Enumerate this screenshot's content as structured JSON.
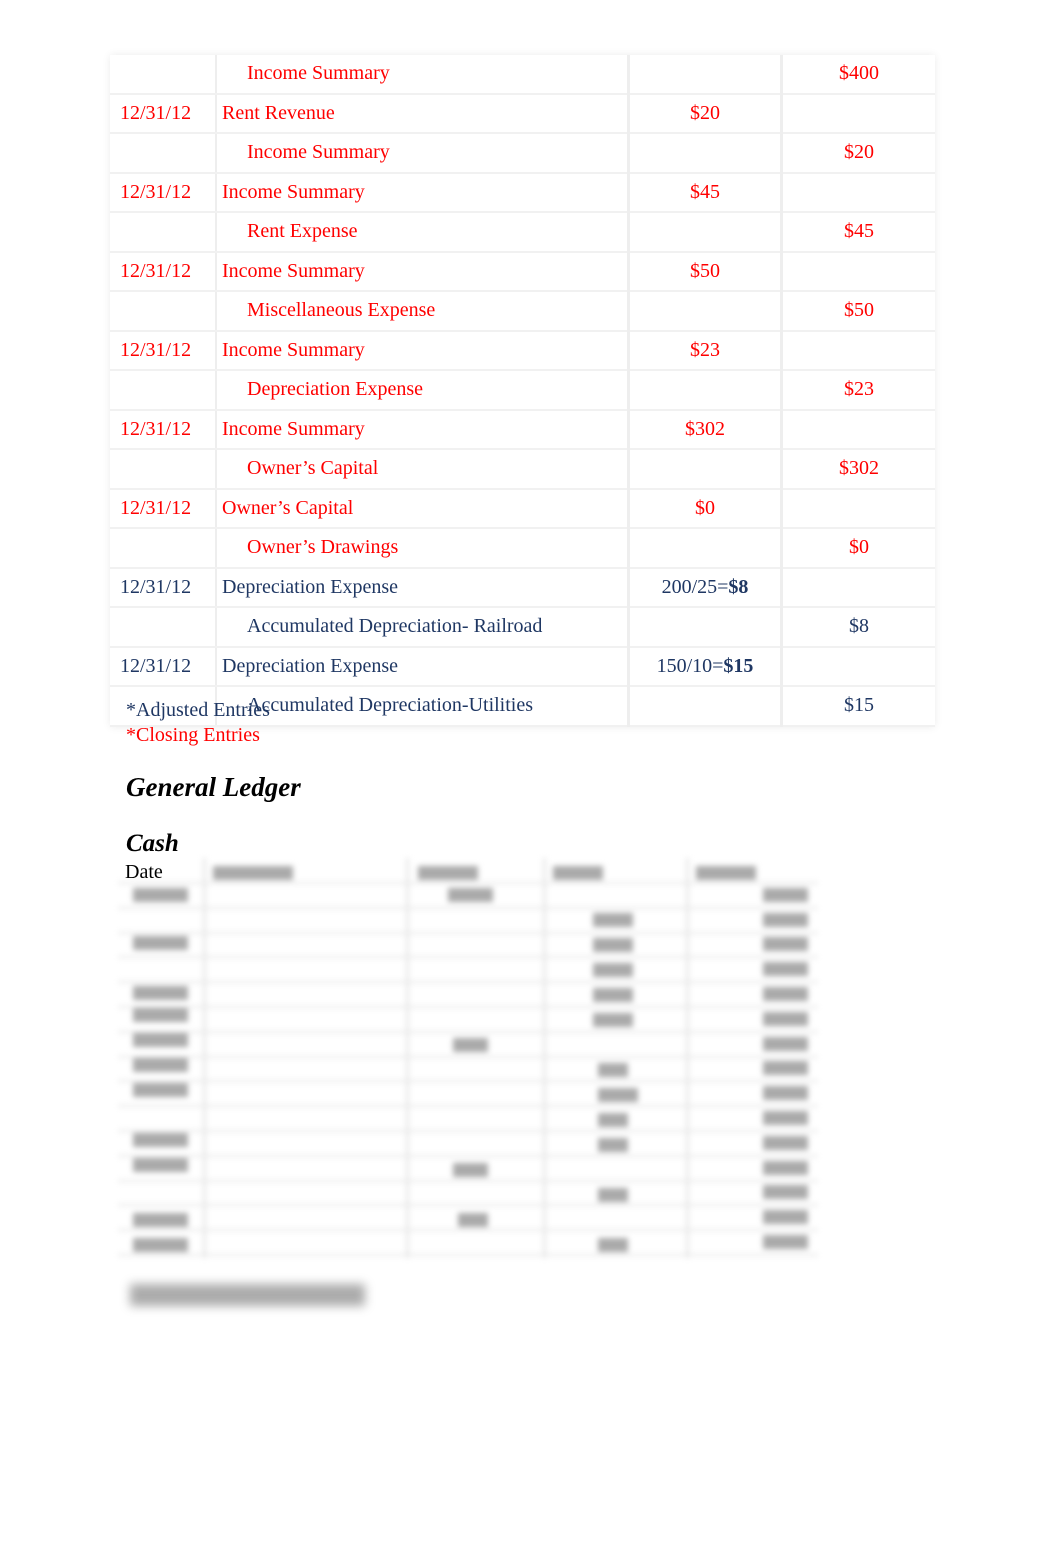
{
  "colors": {
    "closing": "#ff0000",
    "adjusting": "#1f3763"
  },
  "journal": {
    "rows": [
      {
        "date": "",
        "account": "Income Summary",
        "indent": true,
        "debit": "",
        "credit": "$400",
        "type": "closing"
      },
      {
        "date": "12/31/12",
        "account": "Rent Revenue",
        "indent": false,
        "debit": "$20",
        "credit": "",
        "type": "closing"
      },
      {
        "date": "",
        "account": "Income Summary",
        "indent": true,
        "debit": "",
        "credit": "$20",
        "type": "closing"
      },
      {
        "date": "12/31/12",
        "account": "Income Summary",
        "indent": false,
        "debit": "$45",
        "credit": "",
        "type": "closing"
      },
      {
        "date": "",
        "account": "Rent Expense",
        "indent": true,
        "debit": "",
        "credit": "$45",
        "type": "closing"
      },
      {
        "date": "12/31/12",
        "account": "Income Summary",
        "indent": false,
        "debit": "$50",
        "credit": "",
        "type": "closing"
      },
      {
        "date": "",
        "account": "Miscellaneous Expense",
        "indent": true,
        "debit": "",
        "credit": "$50",
        "type": "closing"
      },
      {
        "date": "12/31/12",
        "account": "Income Summary",
        "indent": false,
        "debit": "$23",
        "credit": "",
        "type": "closing"
      },
      {
        "date": "",
        "account": "Depreciation Expense",
        "indent": true,
        "debit": "",
        "credit": "$23",
        "type": "closing"
      },
      {
        "date": "12/31/12",
        "account": "Income Summary",
        "indent": false,
        "debit": "$302",
        "credit": "",
        "type": "closing"
      },
      {
        "date": "",
        "account": "Owner’s Capital",
        "indent": true,
        "debit": "",
        "credit": "$302",
        "type": "closing"
      },
      {
        "date": "12/31/12",
        "account": "Owner’s Capital",
        "indent": false,
        "debit": "$0",
        "credit": "",
        "type": "closing"
      },
      {
        "date": "",
        "account": "Owner’s Drawings",
        "indent": true,
        "debit": "",
        "credit": "$0",
        "type": "closing"
      },
      {
        "date": "12/31/12",
        "account": "Depreciation Expense",
        "indent": false,
        "debit": "200/25=",
        "debit_bold": "$8",
        "credit": "",
        "type": "adjusting"
      },
      {
        "date": "",
        "account": "Accumulated Depreciation- Railroad",
        "indent": true,
        "debit": "",
        "credit": "$8",
        "type": "adjusting"
      },
      {
        "date": "12/31/12",
        "account": "Depreciation Expense",
        "indent": false,
        "debit": "150/10=",
        "debit_bold": "$15",
        "credit": "",
        "type": "adjusting"
      },
      {
        "date": "",
        "account": "Accumulated Depreciation-Utilities",
        "indent": true,
        "debit": "",
        "credit": "$15",
        "type": "adjusting"
      }
    ]
  },
  "legend": {
    "adjusted": "*Adjusted Entries",
    "closing": "*Closing Entries"
  },
  "general_ledger": {
    "title": "General Ledger",
    "cash_title": "Cash",
    "date_header": "Date"
  }
}
